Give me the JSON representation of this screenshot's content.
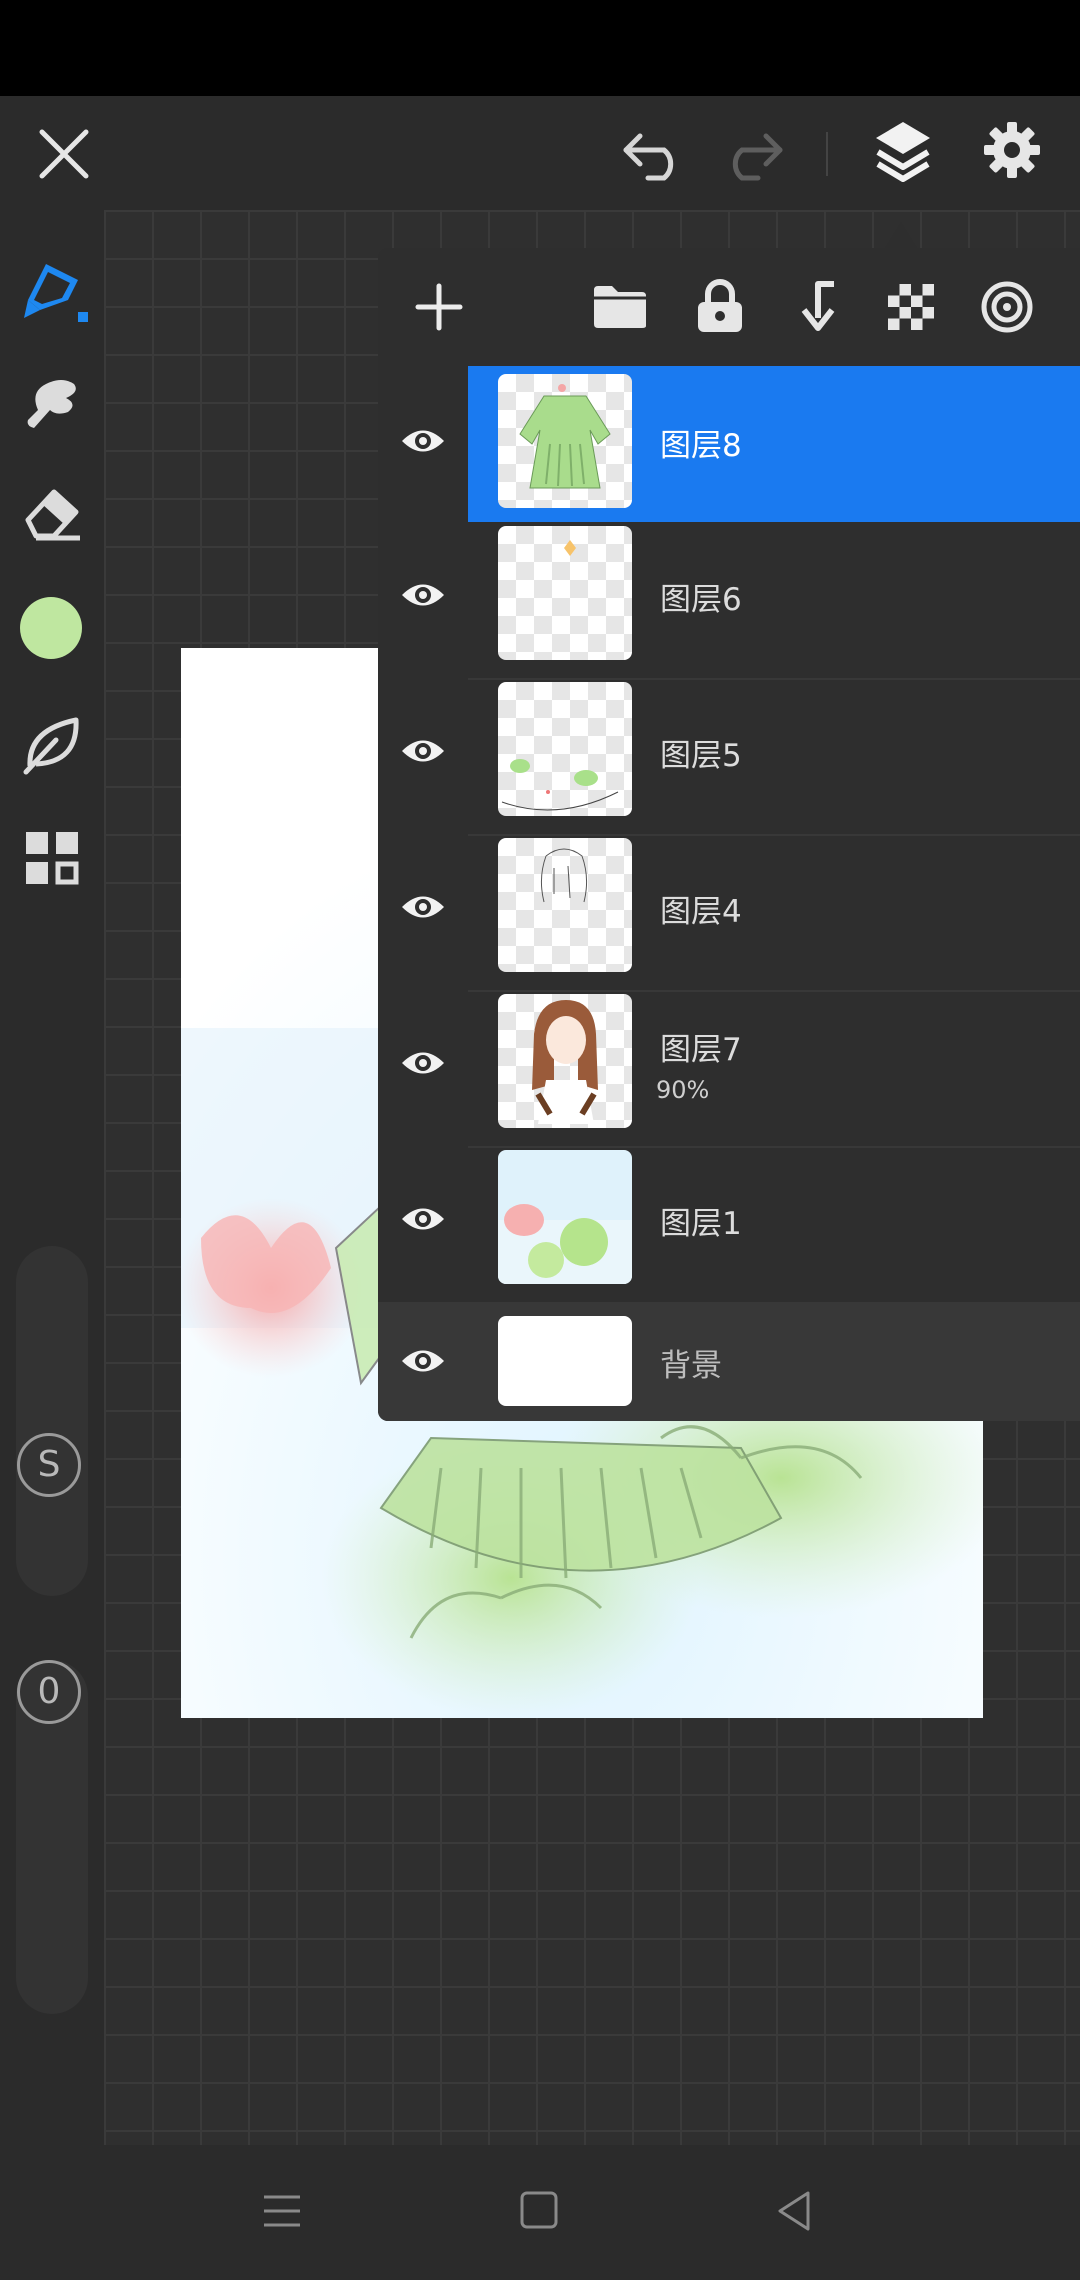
{
  "colors": {
    "accent": "#1a7af0",
    "current_brush_color": "#bfe7a0",
    "background": "#2b2b2b",
    "panel": "#2e2e2e"
  },
  "toolbar_top": {
    "close_icon": "close-icon",
    "undo_icon": "undo-icon",
    "redo_icon": "redo-icon",
    "layers_icon": "layers-icon",
    "settings_icon": "gear-icon"
  },
  "toolbar_left": {
    "tools": [
      "pen-tool",
      "smudge-tool",
      "eraser-tool",
      "color-swatch",
      "leaf-brush-tool",
      "gallery-tool"
    ],
    "badge_s": "S",
    "badge_0": "0"
  },
  "layers_toolbar": {
    "icons": [
      "add-icon",
      "folder-icon",
      "lock-icon",
      "merge-down-icon",
      "transparency-icon",
      "blend-mode-icon"
    ]
  },
  "layers": [
    {
      "name": "图层8",
      "opacity": "",
      "selected": true
    },
    {
      "name": "图层6",
      "opacity": "",
      "selected": false
    },
    {
      "name": "图层5",
      "opacity": "",
      "selected": false
    },
    {
      "name": "图层4",
      "opacity": "",
      "selected": false
    },
    {
      "name": "图层7",
      "opacity": "90%",
      "selected": false
    },
    {
      "name": "图层1",
      "opacity": "",
      "selected": false
    }
  ],
  "background_layer": {
    "name": "背景"
  }
}
